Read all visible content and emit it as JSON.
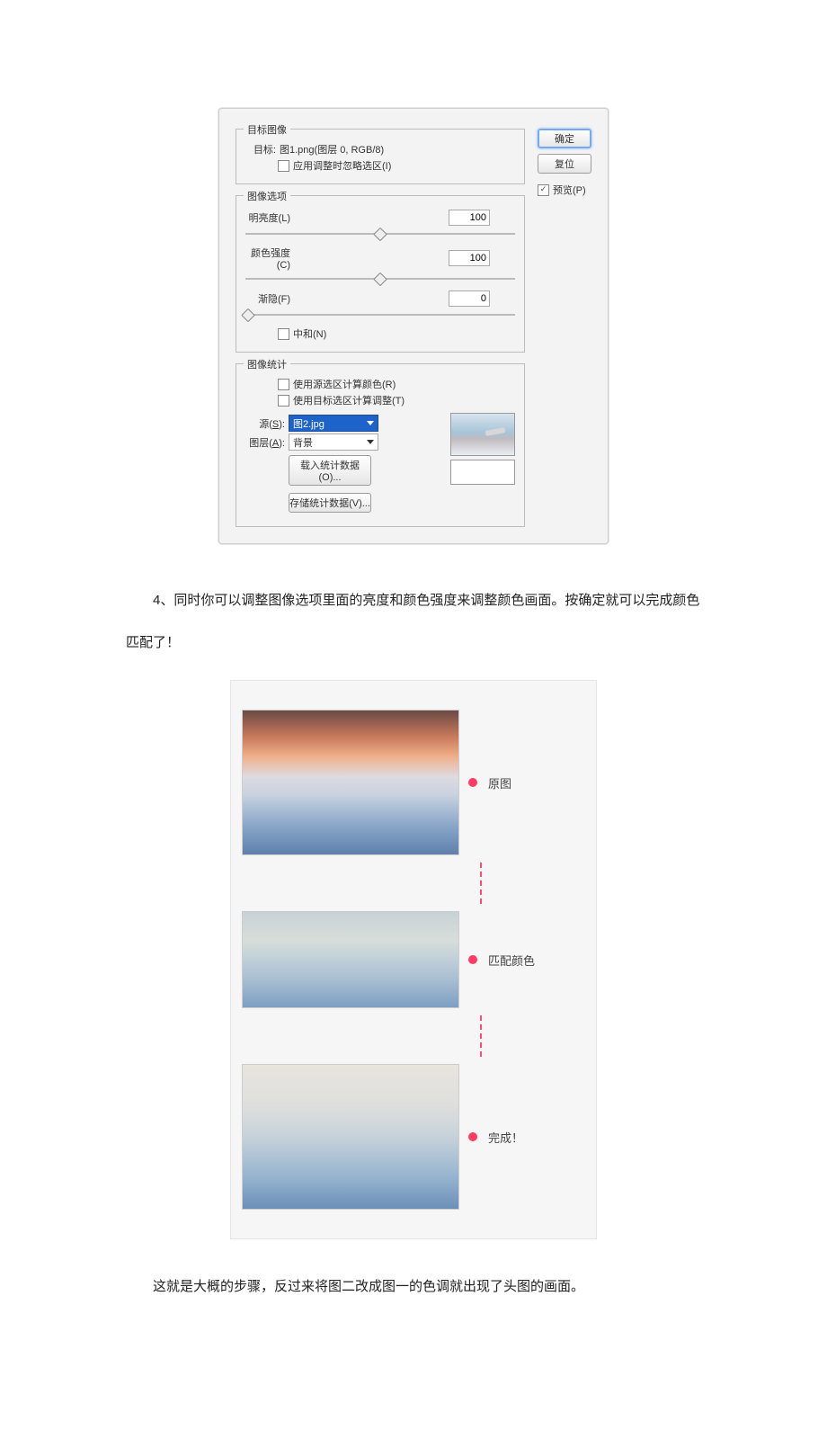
{
  "dialog": {
    "groups": {
      "target": {
        "title": "目标图像",
        "target_label": "目标:",
        "target_value": "图1.png(图层 0, RGB/8)",
        "ignore_selection": "应用调整时忽略选区(I)"
      },
      "options": {
        "title": "图像选项",
        "luminance": {
          "label": "明亮度(L)",
          "value": "100",
          "pos": 50
        },
        "intensity": {
          "label": "颜色强度(C)",
          "value": "100",
          "pos": 50
        },
        "fade": {
          "label": "渐隐(F)",
          "value": "0",
          "pos": 0
        },
        "neutralize": "中和(N)"
      },
      "stats": {
        "title": "图像统计",
        "use_src_sel": "使用源选区计算颜色(R)",
        "use_tgt_sel": "使用目标选区计算调整(T)",
        "source_label": "源(S):",
        "source_value": "图2.jpg",
        "layer_label": "图层(A):",
        "layer_value": "背景",
        "load_btn": "载入统计数据(O)...",
        "save_btn": "存储统计数据(V)..."
      }
    },
    "buttons": {
      "ok": "确定",
      "reset": "复位",
      "preview": "预览(P)"
    }
  },
  "body": {
    "para1": "　　4、同时你可以调整图像选项里面的亮度和颜色强度来调整颜色画面。按确定就可以完成颜色匹配了！",
    "para2": "　　这就是大概的步骤，反过来将图二改成图一的色调就出现了头图的画面。"
  },
  "result": {
    "l1": "原图",
    "l2": "匹配颜色",
    "l3": "完成！"
  }
}
